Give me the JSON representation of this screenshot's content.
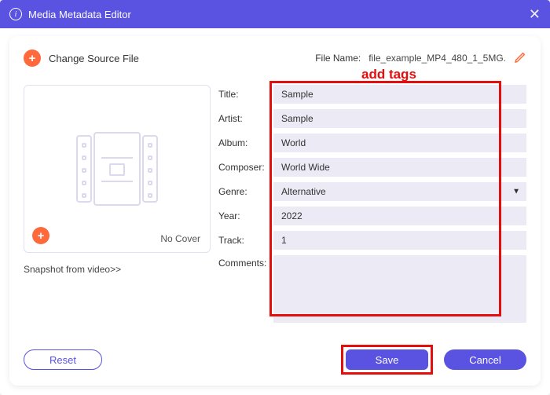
{
  "titlebar": {
    "title": "Media Metadata Editor"
  },
  "panel": {
    "change_source": "Change Source File",
    "file_label": "File Name:",
    "file_name": "file_example_MP4_480_1_5MG."
  },
  "callout": {
    "add_tags": "add tags"
  },
  "cover": {
    "no_cover": "No Cover",
    "snapshot": "Snapshot from video>>"
  },
  "form": {
    "title_label": "Title:",
    "title_value": "Sample",
    "artist_label": "Artist:",
    "artist_value": "Sample",
    "album_label": "Album:",
    "album_value": "World",
    "composer_label": "Composer:",
    "composer_value": "World Wide",
    "genre_label": "Genre:",
    "genre_value": "Alternative",
    "year_label": "Year:",
    "year_value": "2022",
    "track_label": "Track:",
    "track_value": "1",
    "comments_label": "Comments:",
    "comments_value": ""
  },
  "buttons": {
    "reset": "Reset",
    "save": "Save",
    "cancel": "Cancel"
  }
}
